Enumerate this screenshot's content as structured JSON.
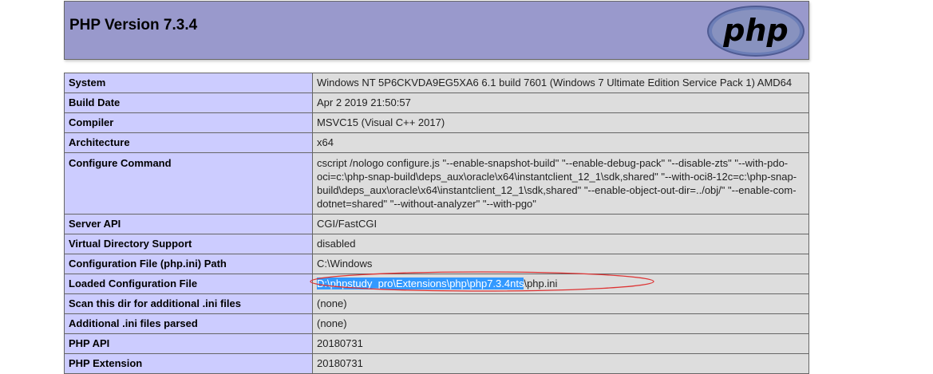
{
  "header": {
    "title": "PHP Version 7.3.4",
    "logo_text": "php"
  },
  "rows": [
    {
      "key": "System",
      "value": "Windows NT 5P6CKVDA9EG5XA6 6.1 build 7601 (Windows 7 Ultimate Edition Service Pack 1) AMD64"
    },
    {
      "key": "Build Date",
      "value": "Apr 2 2019 21:50:57"
    },
    {
      "key": "Compiler",
      "value": "MSVC15 (Visual C++ 2017)"
    },
    {
      "key": "Architecture",
      "value": "x64"
    },
    {
      "key": "Configure Command",
      "value": "cscript /nologo configure.js \"--enable-snapshot-build\" \"--enable-debug-pack\" \"--disable-zts\" \"--with-pdo-oci=c:\\php-snap-build\\deps_aux\\oracle\\x64\\instantclient_12_1\\sdk,shared\" \"--with-oci8-12c=c:\\php-snap-build\\deps_aux\\oracle\\x64\\instantclient_12_1\\sdk,shared\" \"--enable-object-out-dir=../obj/\" \"--enable-com-dotnet=shared\" \"--without-analyzer\" \"--with-pgo\""
    },
    {
      "key": "Server API",
      "value": "CGI/FastCGI"
    },
    {
      "key": "Virtual Directory Support",
      "value": "disabled"
    },
    {
      "key": "Configuration File (php.ini) Path",
      "value": "C:\\Windows"
    },
    {
      "key": "Loaded Configuration File",
      "value_selected": "D:\\phpstudy_pro\\Extensions\\php\\php7.3.4nts",
      "value_rest": "\\php.ini"
    },
    {
      "key": "Scan this dir for additional .ini files",
      "value": "(none)"
    },
    {
      "key": "Additional .ini files parsed",
      "value": "(none)"
    },
    {
      "key": "PHP API",
      "value": "20180731"
    },
    {
      "key": "PHP Extension",
      "value": "20180731"
    }
  ],
  "colors": {
    "header_bg": "#9999cc",
    "key_bg": "#ccccff",
    "value_bg": "#dddddd",
    "selection": "#3399ff",
    "annotation": "#dd3333"
  }
}
